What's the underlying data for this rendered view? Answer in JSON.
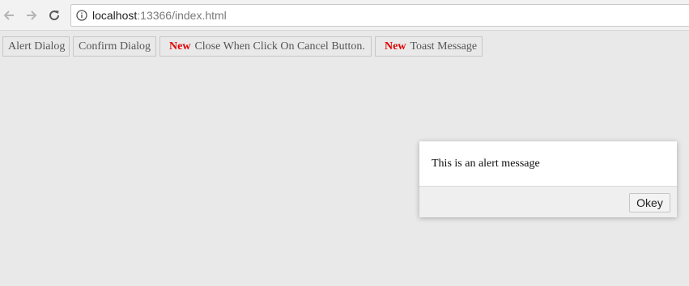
{
  "browser": {
    "url_host": "localhost",
    "url_rest": ":13366/index.html",
    "icons": {
      "back": "arrow-left",
      "forward": "arrow-right",
      "reload": "reload",
      "site_info": "info-circle"
    }
  },
  "toolbar": {
    "buttons": [
      {
        "label": "Alert Dialog"
      },
      {
        "label": "Confirm Dialog"
      },
      {
        "badge": "New",
        "label": "Close When Click On Cancel Button."
      },
      {
        "badge": "New",
        "label": "Toast Message"
      }
    ],
    "badge_color": "#e00000"
  },
  "dialog": {
    "message": "This is an alert message",
    "ok_label": "Okey"
  }
}
